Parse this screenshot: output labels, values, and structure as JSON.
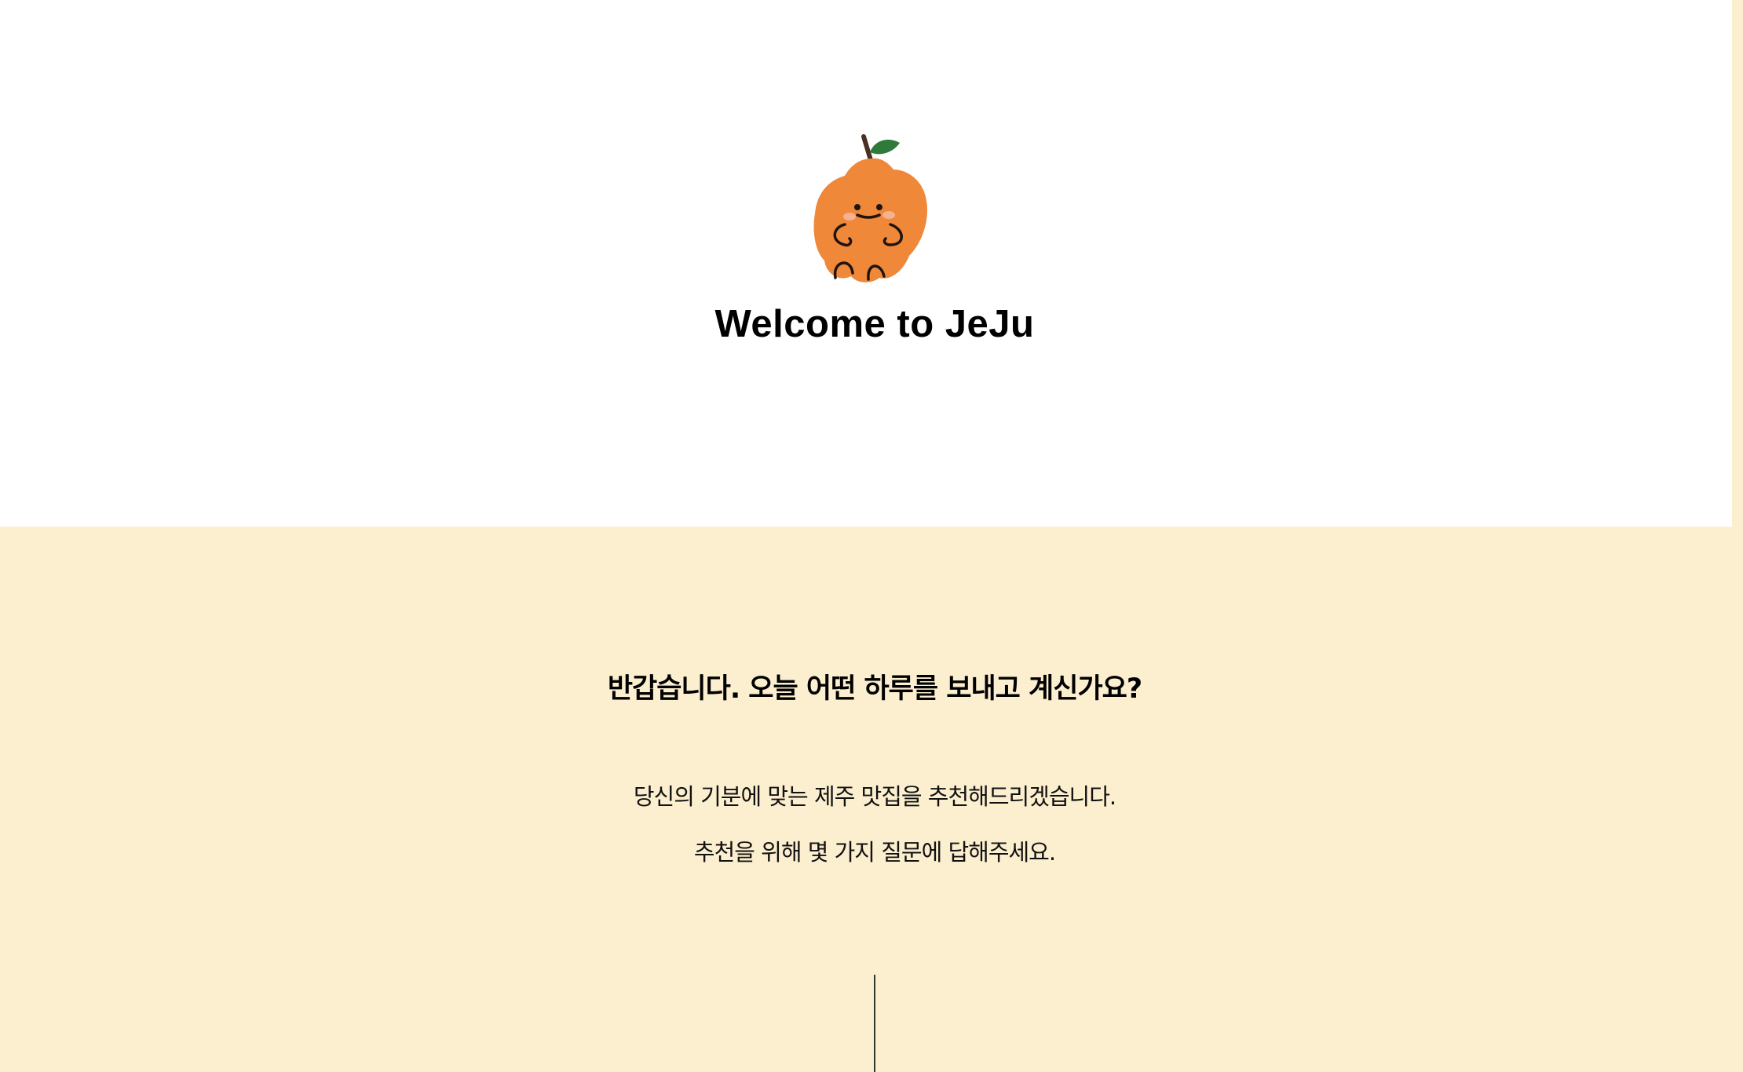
{
  "hero": {
    "mascot_icon": "tangerine-mascot-icon",
    "title": "Welcome to JeJu"
  },
  "intro": {
    "question": "반갑습니다. 오늘 어떤 하루를 보내고 계신가요?",
    "description_line_1": "당신의 기분에 맞는 제주 맛집을 추천해드리겠습니다.",
    "description_line_2": "추천을 위해 몇 가지 질문에 답해주세요."
  },
  "colors": {
    "intro_background": "#fcefcf",
    "mascot_orange": "#f0883a",
    "leaf_green": "#2e7a3a",
    "stem_brown": "#4a2f22"
  }
}
